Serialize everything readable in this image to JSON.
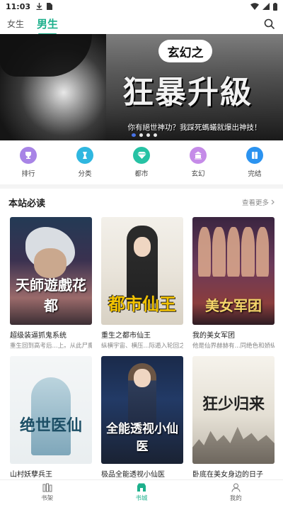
{
  "status": {
    "time": "11:03"
  },
  "colors": {
    "accent": "#1db08c"
  },
  "tabs": [
    {
      "label": "女生",
      "active": false
    },
    {
      "label": "男生",
      "active": true
    }
  ],
  "banner": {
    "badge": "玄幻之",
    "title": "狂暴升級",
    "tagline": "你有絕世神功？我踩死螞蟻就爆出神技！",
    "slide_count": 4,
    "active_slide": 1
  },
  "quick_nav": [
    {
      "label": "排行",
      "icon": "trophy-icon",
      "color": "#a884e6"
    },
    {
      "label": "分类",
      "icon": "bow-tie-icon",
      "color": "#2fb7e0"
    },
    {
      "label": "都市",
      "icon": "diamond-icon",
      "color": "#26c2a4"
    },
    {
      "label": "玄幻",
      "icon": "building-icon",
      "color": "#c58be8"
    },
    {
      "label": "完结",
      "icon": "book-icon",
      "color": "#2b93f0"
    }
  ],
  "section": {
    "title": "本站必读",
    "more": "查看更多"
  },
  "books": [
    {
      "title": "超级装逼抓鬼系统",
      "desc": "重生回到高考后...上。从此尸魔鬼",
      "cover_text": "天師遊戲花都"
    },
    {
      "title": "重生之都市仙王",
      "desc": "纵横宇宙、横压...际遁入轮回之门",
      "cover_text": "都市仙王"
    },
    {
      "title": "我的美女军团",
      "desc": "他是仙界赫赫有...同绝色和娇纵性",
      "cover_text": "美女军团"
    },
    {
      "title": "山村妖孽兵王",
      "desc": "",
      "cover_text": "绝世医仙"
    },
    {
      "title": "极品全能透视小仙医",
      "desc": "",
      "cover_text": "全能透视小仙医"
    },
    {
      "title": "卧底在美女身边的日子",
      "desc": "",
      "cover_text": "狂少归来"
    }
  ],
  "bottom_nav": [
    {
      "label": "书架",
      "icon": "bookshelf-icon",
      "active": false
    },
    {
      "label": "书城",
      "icon": "store-icon",
      "active": true
    },
    {
      "label": "我的",
      "icon": "profile-icon",
      "active": false
    }
  ]
}
